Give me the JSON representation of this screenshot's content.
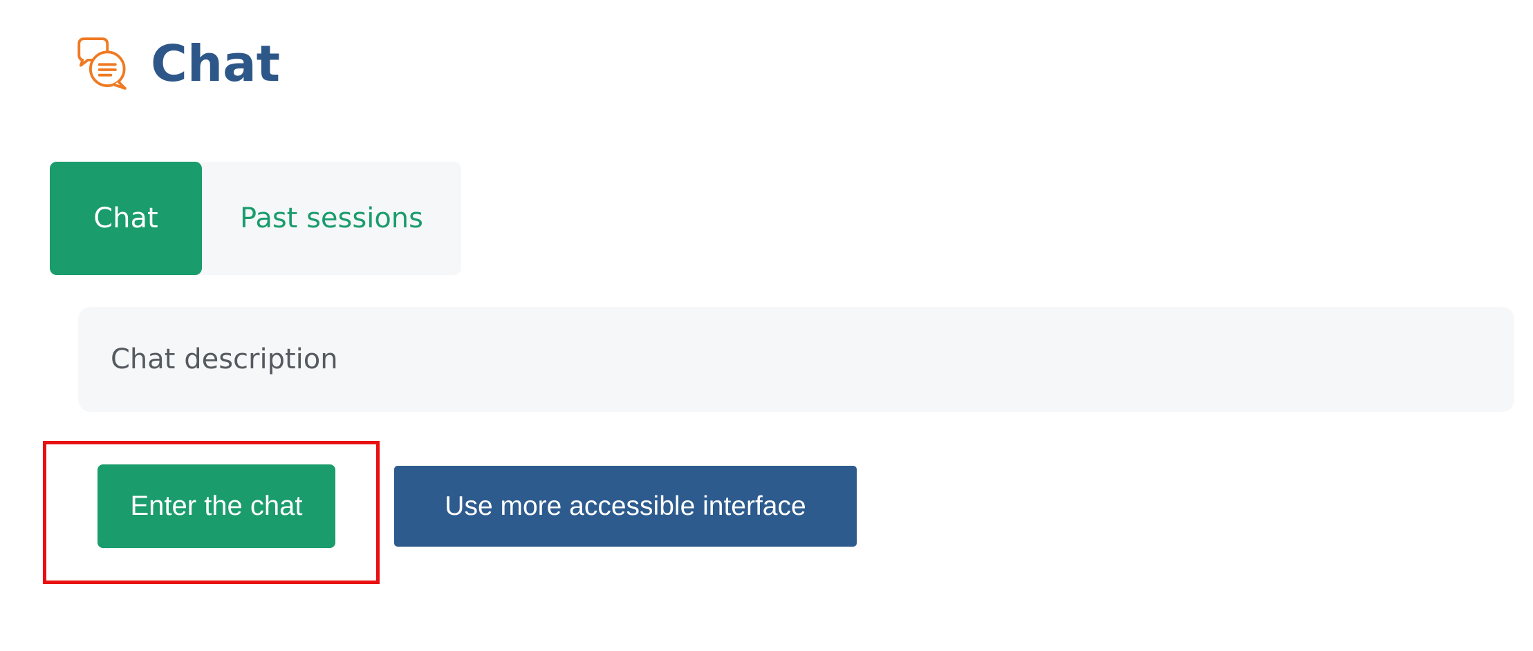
{
  "header": {
    "icon": "chat-bubbles-icon",
    "title": "Chat"
  },
  "tabs": [
    {
      "label": "Chat",
      "active": true
    },
    {
      "label": "Past sessions",
      "active": false
    }
  ],
  "description": {
    "text": "Chat description"
  },
  "actions": {
    "enter_label": "Enter the chat",
    "accessible_label": "Use more accessible interface"
  },
  "colors": {
    "primary_green": "#1a9c6c",
    "title_blue": "#2d5788",
    "button_blue": "#2d5b8e",
    "icon_orange": "#ef7a22",
    "highlight_red": "#e81010",
    "panel_gray": "#f6f7f8"
  }
}
